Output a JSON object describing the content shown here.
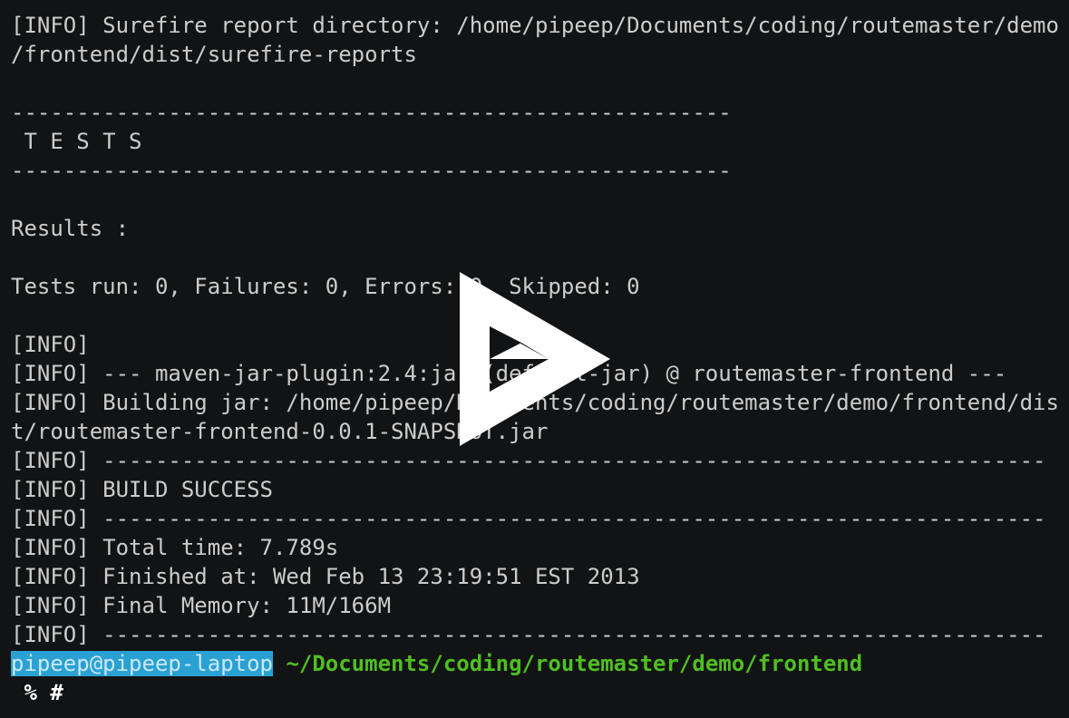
{
  "terminal": {
    "lines": [
      "[INFO] Surefire report directory: /home/pipeep/Documents/coding/routemaster/demo",
      "/frontend/dist/surefire-reports",
      "",
      "-------------------------------------------------------",
      " T E S T S",
      "-------------------------------------------------------",
      "",
      "Results :",
      "",
      "Tests run: 0, Failures: 0, Errors: 0, Skipped: 0",
      "",
      "[INFO]",
      "[INFO] --- maven-jar-plugin:2.4:jar (default-jar) @ routemaster-frontend ---",
      "[INFO] Building jar: /home/pipeep/Documents/coding/routemaster/demo/frontend/dis",
      "t/routemaster-frontend-0.0.1-SNAPSHOT.jar",
      "[INFO] ------------------------------------------------------------------------",
      "[INFO] BUILD SUCCESS",
      "[INFO] ------------------------------------------------------------------------",
      "[INFO] Total time: 7.789s",
      "[INFO] Finished at: Wed Feb 13 23:19:51 EST 2013",
      "[INFO] Final Memory: 11M/166M",
      "[INFO] ------------------------------------------------------------------------"
    ],
    "prompt": {
      "user_host": "pipeep@pipeep-laptop",
      "cwd": "~/Documents/coding/routemaster/demo/frontend",
      "symbols": " % #"
    }
  },
  "overlay": {
    "icon": "play-icon",
    "color": "#ffffff"
  },
  "colors": {
    "background": "#121314",
    "text": "#cccccc",
    "user_host_bg": "#2aa1d3",
    "cwd": "#4ebf22"
  }
}
